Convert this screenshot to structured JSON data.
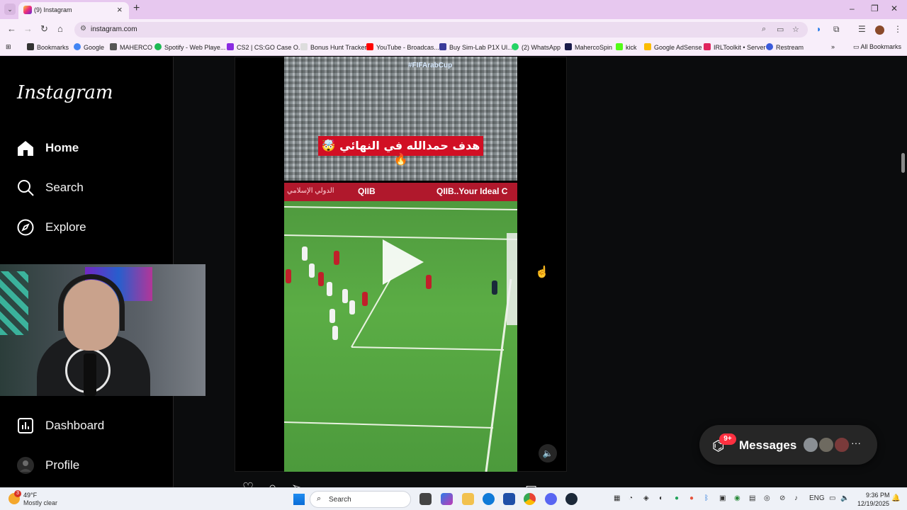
{
  "browser": {
    "tab_title": "(9) Instagram",
    "url": "instagram.com",
    "bookmarks": [
      {
        "label": "Bookmarks",
        "color": "#333333"
      },
      {
        "label": "Google",
        "color": "#4285f4"
      },
      {
        "label": "MAHERCO",
        "color": "#555555"
      },
      {
        "label": "Spotify - Web Playe...",
        "color": "#1db954"
      },
      {
        "label": "CS2 | CS:GO Case O...",
        "color": "#8a2be2"
      },
      {
        "label": "Bonus Hunt Tracker",
        "color": "#dddddd"
      },
      {
        "label": "YouTube - Broadcas...",
        "color": "#ff0000"
      },
      {
        "label": "Buy Sim-Lab P1X Ul...",
        "color": "#3a3a9a"
      },
      {
        "label": "(2) WhatsApp",
        "color": "#25d366"
      },
      {
        "label": "MahercoSpin",
        "color": "#1a1a4a"
      },
      {
        "label": "kick",
        "color": "#53fc18"
      },
      {
        "label": "Google AdSense",
        "color": "#fbbc04"
      },
      {
        "label": "IRLToolkit • Server",
        "color": "#e0245e"
      },
      {
        "label": "Restream",
        "color": "#3b5bdb"
      }
    ],
    "all_bookmarks": "All Bookmarks"
  },
  "sidebar": {
    "logo": "Instagram",
    "items": [
      {
        "label": "Home",
        "icon": "home-icon"
      },
      {
        "label": "Search",
        "icon": "search-icon"
      },
      {
        "label": "Explore",
        "icon": "compass-icon"
      },
      {
        "label": "Dashboard",
        "icon": "dashboard-icon"
      },
      {
        "label": "Profile",
        "icon": "profile-avatar"
      }
    ]
  },
  "post": {
    "video_caption": "هدف حمدالله في النهائي 🤯🔥",
    "stadium_tag": "#FIFArabCup",
    "ad_left": "QIIB",
    "ad_right": "QIIB..Your Ideal C",
    "ad_arabic": "الدولي الإسلامي"
  },
  "messages": {
    "label": "Messages",
    "badge": "9+"
  },
  "taskbar": {
    "weather_badge": "3",
    "temperature": "49°F",
    "weather": "Mostly clear",
    "search_label": "Search",
    "lang": "ENG",
    "time": "9:36 PM",
    "date": "12/19/2025"
  }
}
